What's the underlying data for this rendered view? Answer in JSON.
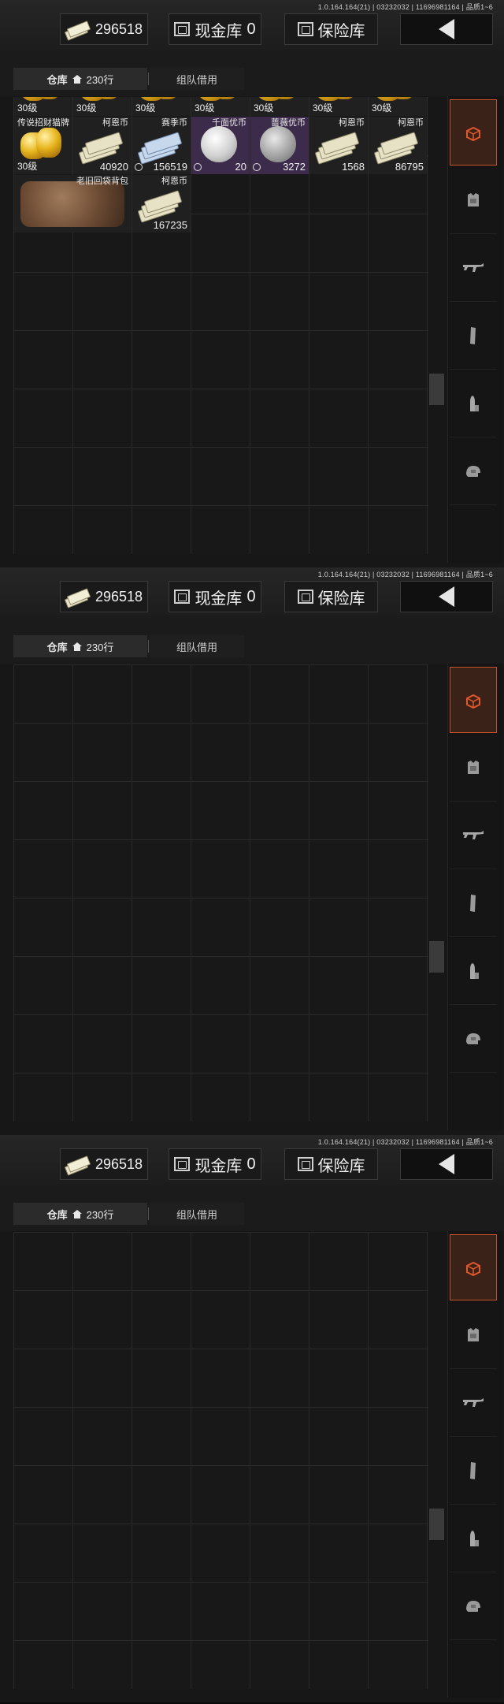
{
  "frames": [
    {
      "id": "panel-1"
    },
    {
      "id": "panel-2"
    },
    {
      "id": "panel-3"
    }
  ],
  "header": {
    "version": "1.0.164.164(21) | 03232032 | 11696981164 | 品质1~6",
    "money_value": "296518",
    "cash_vault_label": "现金库",
    "cash_vault_count": "0",
    "insurance_label": "保险库"
  },
  "tabs": {
    "warehouse_label": "仓库",
    "rows_label": "230行",
    "team_label": "组队借用"
  },
  "sidebar": {
    "items": [
      {
        "name": "all-items",
        "icon": "stack-refresh-icon"
      },
      {
        "name": "category-box",
        "icon": "box-icon"
      },
      {
        "name": "category-armor",
        "icon": "vest-icon"
      },
      {
        "name": "category-weapon",
        "icon": "rifle-icon"
      },
      {
        "name": "category-magazine",
        "icon": "magazine-icon"
      },
      {
        "name": "category-ammo",
        "icon": "bullet-icon"
      },
      {
        "name": "category-helmet",
        "icon": "helmet-icon"
      }
    ],
    "active_color": "#c4532a"
  },
  "items": {
    "top_row_level": "30级",
    "lucky_cat_name": "传说招财猫牌",
    "lucky_cat_level": "30级",
    "kern_coin_name": "柯恩币",
    "kern_coin_1_count": "40920",
    "season_coin_name": "赛季币",
    "season_coin_count": "156519",
    "qianmian_name": "千面优币",
    "qianmian_count": "20",
    "rose_name": "蔷薇优币",
    "rose_count": "3272",
    "kern_coin_2_count": "1568",
    "kern_coin_3_count": "86795",
    "backpack_name": "老旧回袋背包",
    "kern_coin_4_count": "167235"
  }
}
